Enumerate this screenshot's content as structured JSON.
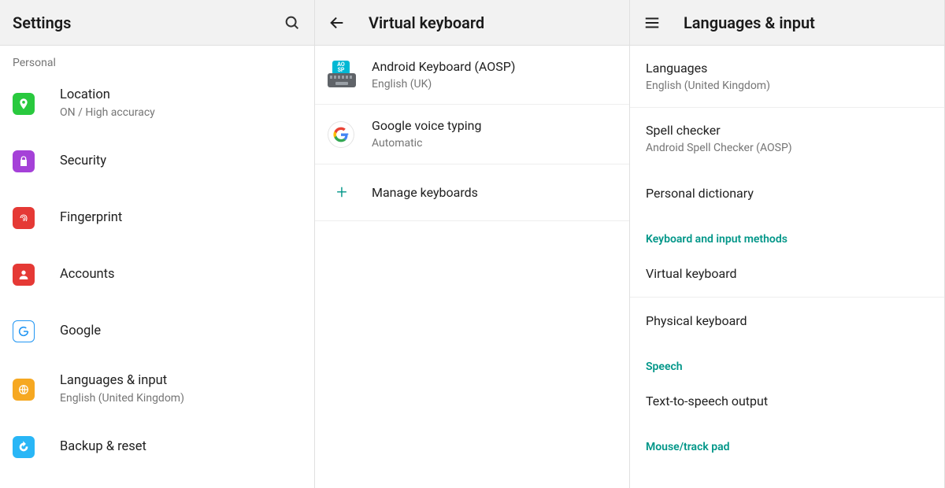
{
  "settings": {
    "title": "Settings",
    "category": "Personal",
    "items": [
      {
        "label": "Location",
        "sub": "ON / High accuracy"
      },
      {
        "label": "Security"
      },
      {
        "label": "Fingerprint"
      },
      {
        "label": "Accounts"
      },
      {
        "label": "Google"
      },
      {
        "label": "Languages & input",
        "sub": "English (United Kingdom)"
      },
      {
        "label": "Backup & reset"
      }
    ]
  },
  "virtualKeyboard": {
    "title": "Virtual keyboard",
    "items": [
      {
        "label": "Android Keyboard (AOSP)",
        "sub": "English (UK)"
      },
      {
        "label": "Google voice typing",
        "sub": "Automatic"
      },
      {
        "label": "Manage keyboards"
      }
    ],
    "aospBadge": "AO\nSP"
  },
  "langInput": {
    "title": "Languages & input",
    "items": [
      {
        "label": "Languages",
        "sub": "English (United Kingdom)"
      },
      {
        "label": "Spell checker",
        "sub": "Android Spell Checker (AOSP)"
      },
      {
        "label": "Personal dictionary"
      }
    ],
    "cat1": "Keyboard and input methods",
    "items2": [
      {
        "label": "Virtual keyboard"
      },
      {
        "label": "Physical keyboard"
      }
    ],
    "cat2": "Speech",
    "items3": [
      {
        "label": "Text-to-speech output"
      }
    ],
    "cat3": "Mouse/track pad"
  }
}
